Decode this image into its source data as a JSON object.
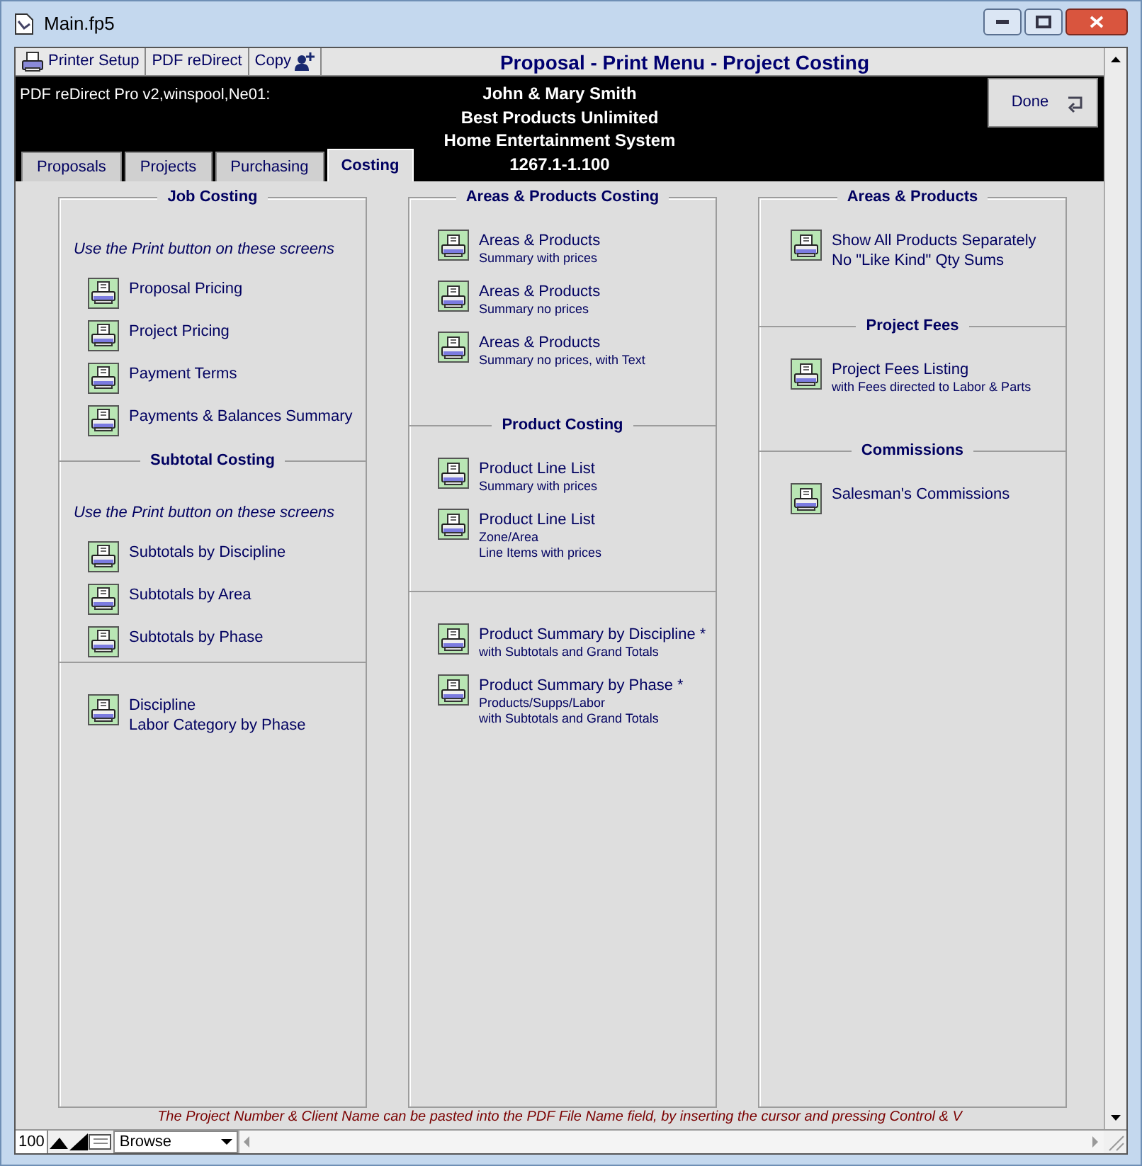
{
  "window": {
    "title": "Main.fp5"
  },
  "toolbar": {
    "buttons": [
      {
        "label": "Printer Setup",
        "kind": "printer"
      },
      {
        "label": "PDF reDirect",
        "kind": "plain"
      },
      {
        "label": "Copy",
        "kind": "copy"
      }
    ],
    "title": "Proposal - Print Menu - Project Costing"
  },
  "header": {
    "printer_info": "PDF reDirect Pro v2,winspool,Ne01:",
    "lines": [
      "John & Mary Smith",
      "Best Products Unlimited",
      "Home Entertainment System",
      "1267.1-1.100"
    ],
    "done_button": "Done"
  },
  "tabs": [
    {
      "label": "Proposals",
      "selected": false
    },
    {
      "label": "Projects",
      "selected": false
    },
    {
      "label": "Purchasing",
      "selected": false
    },
    {
      "label": "Costing",
      "selected": true
    }
  ],
  "columns": [
    {
      "sections": [
        {
          "heading": "Job Costing",
          "note": "Use the Print button on these screens",
          "items": [
            {
              "lines": [
                {
                  "text": "Proposal Pricing",
                  "kind": "main"
                }
              ]
            },
            {
              "lines": [
                {
                  "text": "Project Pricing",
                  "kind": "main"
                }
              ]
            },
            {
              "lines": [
                {
                  "text": "Payment Terms",
                  "kind": "main"
                }
              ]
            },
            {
              "lines": [
                {
                  "text": "Payments & Balances Summary",
                  "kind": "main"
                }
              ]
            }
          ]
        },
        {
          "heading": "Subtotal Costing",
          "note": "Use the Print button on these screens",
          "items": [
            {
              "lines": [
                {
                  "text": "Subtotals by Discipline",
                  "kind": "main"
                }
              ]
            },
            {
              "lines": [
                {
                  "text": "Subtotals by Area",
                  "kind": "main"
                }
              ]
            },
            {
              "lines": [
                {
                  "text": "Subtotals by Phase",
                  "kind": "main"
                }
              ]
            }
          ]
        },
        {
          "items": [
            {
              "lines": [
                {
                  "text": "Discipline",
                  "kind": "main"
                },
                {
                  "text": "Labor Category by Phase",
                  "kind": "main"
                }
              ]
            }
          ]
        }
      ]
    },
    {
      "sections": [
        {
          "heading": "Areas & Products Costing",
          "items": [
            {
              "lines": [
                {
                  "text": "Areas & Products",
                  "kind": "main"
                },
                {
                  "text": "Summary with prices",
                  "kind": "sub"
                }
              ]
            },
            {
              "lines": [
                {
                  "text": "Areas & Products",
                  "kind": "main"
                },
                {
                  "text": "Summary no prices",
                  "kind": "sub"
                }
              ]
            },
            {
              "lines": [
                {
                  "text": "Areas & Products",
                  "kind": "main"
                },
                {
                  "text": "Summary no prices, with Text",
                  "kind": "sub"
                }
              ]
            }
          ]
        },
        {
          "heading": "Product Costing",
          "items": [
            {
              "lines": [
                {
                  "text": "Product Line List",
                  "kind": "main"
                },
                {
                  "text": "Summary with prices",
                  "kind": "sub"
                }
              ]
            },
            {
              "lines": [
                {
                  "text": "Product Line List",
                  "kind": "main"
                },
                {
                  "text": "Zone/Area",
                  "kind": "sub"
                },
                {
                  "text": "Line Items with prices",
                  "kind": "sub"
                }
              ]
            }
          ]
        },
        {
          "items": [
            {
              "lines": [
                {
                  "text": "Product Summary by Discipline *",
                  "kind": "main"
                },
                {
                  "text": "with Subtotals and Grand Totals",
                  "kind": "sub"
                }
              ]
            },
            {
              "lines": [
                {
                  "text": "Product Summary by Phase *",
                  "kind": "main"
                },
                {
                  "text": "Products/Supps/Labor",
                  "kind": "sub"
                },
                {
                  "text": "with Subtotals and Grand Totals",
                  "kind": "sub"
                }
              ]
            }
          ]
        }
      ]
    },
    {
      "sections": [
        {
          "heading": "Areas & Products",
          "items": [
            {
              "lines": [
                {
                  "text": "Show All Products Separately",
                  "kind": "main"
                },
                {
                  "text": "No \"Like Kind\" Qty Sums",
                  "kind": "main"
                }
              ]
            }
          ]
        },
        {
          "heading": "Project Fees",
          "items": [
            {
              "lines": [
                {
                  "text": "Project Fees Listing",
                  "kind": "main"
                },
                {
                  "text": "with Fees directed to Labor & Parts",
                  "kind": "sub"
                }
              ]
            }
          ]
        },
        {
          "heading": "Commissions",
          "items": [
            {
              "lines": [
                {
                  "text": "Salesman's Commissions",
                  "kind": "main"
                }
              ]
            }
          ]
        }
      ]
    }
  ],
  "footer_note": "The Project Number & Client Name can be pasted into the PDF File Name field, by inserting the cursor and pressing Control & V",
  "status_bar": {
    "zoom": "100",
    "mode": "Browse"
  }
}
